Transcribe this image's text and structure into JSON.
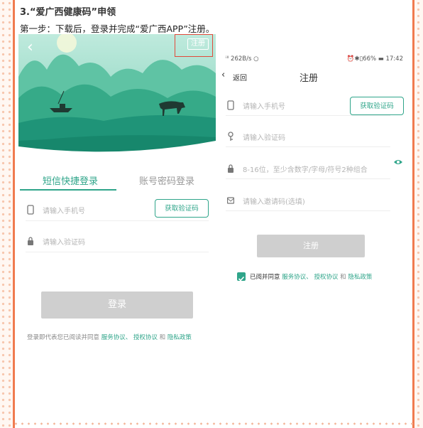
{
  "heading": "3.“爱广西健康码”申领",
  "step_text": "第一步：下载后，登录并完成“爱广西APP”注册。",
  "left": {
    "register_top": "注册",
    "tab_sms": "短信快捷登录",
    "tab_password": "账号密码登录",
    "phone_placeholder": "请输入手机号",
    "get_code": "获取验证码",
    "code_placeholder": "请输入验证码",
    "login_button": "登录",
    "agree_prefix": "登录即代表您已阅读并同意",
    "link_service": "服务协议、",
    "link_auth": "授权协议",
    "and": "和",
    "link_privacy": "隐私政策"
  },
  "right": {
    "status_left": "ⁱˡˡ 262B/s ○",
    "status_right": "⏰✱▯66% ▬ 17:42",
    "back": "返回",
    "title": "注册",
    "phone_placeholder": "请输入手机号",
    "get_code": "获取验证码",
    "code_placeholder": "请输入验证码",
    "password_placeholder": "8-16位，至少含数字/字母/符号2种组合",
    "invite_placeholder": "请输入邀请码(选填)",
    "register_button": "注册",
    "agree_prefix": "已阅并同意",
    "link_service": "服务协议、",
    "link_auth": "授权协议",
    "and": "和",
    "link_privacy": "隐私政策"
  },
  "colors": {
    "accent": "#2fa58a",
    "border": "#f07b4f",
    "highlight": "#e24a3b"
  }
}
